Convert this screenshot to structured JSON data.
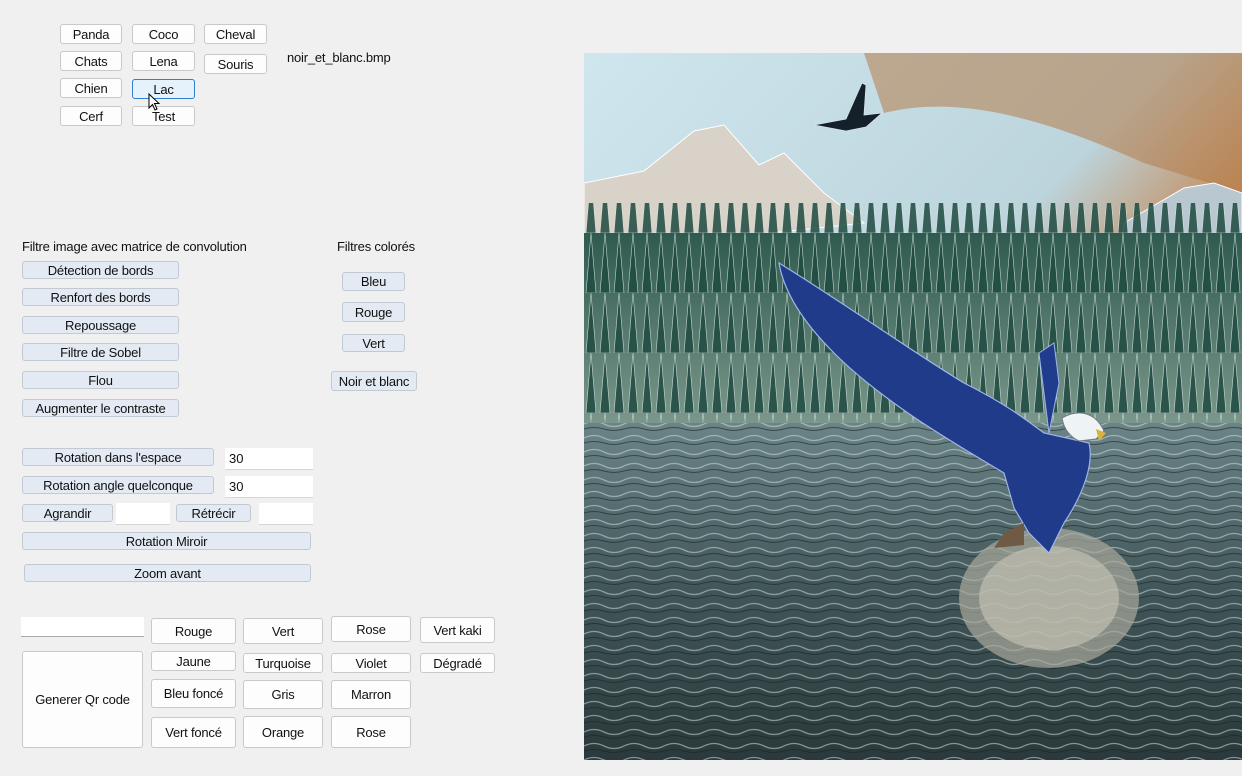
{
  "images": {
    "buttons": [
      "Panda",
      "Coco",
      "Cheval",
      "Chats",
      "Lena",
      "Souris",
      "Chien",
      "Lac",
      "Cerf",
      "Test"
    ],
    "filename": "noir_et_blanc.bmp"
  },
  "convolution": {
    "title": "Filtre image avec matrice  de convolution",
    "buttons": [
      "Détection de bords",
      "Renfort des bords",
      "Repoussage",
      "Filtre de Sobel",
      "Flou",
      "Augmenter le contraste"
    ]
  },
  "colored_filters": {
    "title": "Filtres colorés",
    "buttons": [
      "Bleu",
      "Rouge",
      "Vert",
      "Noir et blanc"
    ]
  },
  "transform": {
    "rot_space_label": "Rotation dans l'espace",
    "rot_space_value": "30",
    "rot_angle_label": "Rotation angle quelconque",
    "rot_angle_value": "30",
    "enlarge_label": "Agrandir",
    "enlarge_value": "",
    "shrink_label": "Rétrécir",
    "shrink_value": "",
    "mirror_label": "Rotation Miroir",
    "zoom_label": "Zoom avant"
  },
  "qr": {
    "input_value": "",
    "generate_label": "Generer Qr code",
    "colors": [
      "Rouge",
      "Vert",
      "Rose",
      "Vert kaki",
      "Jaune",
      "Turquoise",
      "Violet",
      "Dégradé",
      "Bleu foncé",
      "Gris",
      "Marron",
      "Vert foncé",
      "Orange",
      "Rose"
    ]
  }
}
